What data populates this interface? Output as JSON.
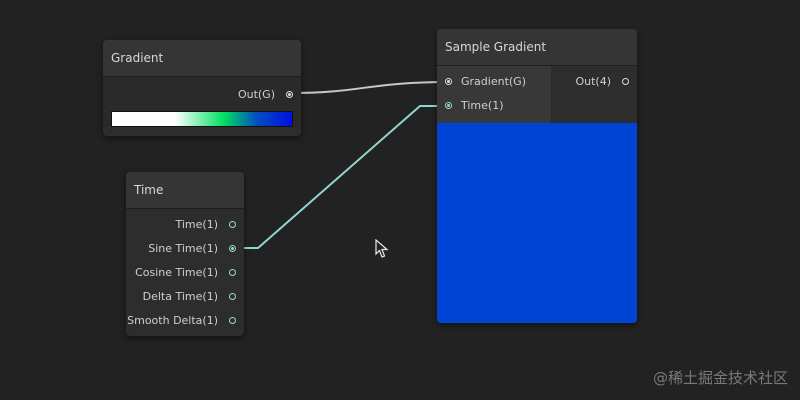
{
  "gradient_node": {
    "title": "Gradient",
    "output": "Out(G)",
    "gradient_colors": [
      "#ffffff",
      "#00e060",
      "#0050c0",
      "#0010e0"
    ]
  },
  "time_node": {
    "title": "Time",
    "outputs": [
      "Time(1)",
      "Sine Time(1)",
      "Cosine Time(1)",
      "Delta Time(1)",
      "Smooth Delta(1)"
    ]
  },
  "sample_node": {
    "title": "Sample Gradient",
    "inputs": [
      "Gradient(G)",
      "Time(1)"
    ],
    "output": "Out(4)",
    "preview_color": "#0044d6"
  },
  "colors": {
    "wire_gradient": "#c8c8c8",
    "wire_float": "#8fd6d0",
    "background": "#222222"
  },
  "watermark": "@稀土掘金技术社区"
}
